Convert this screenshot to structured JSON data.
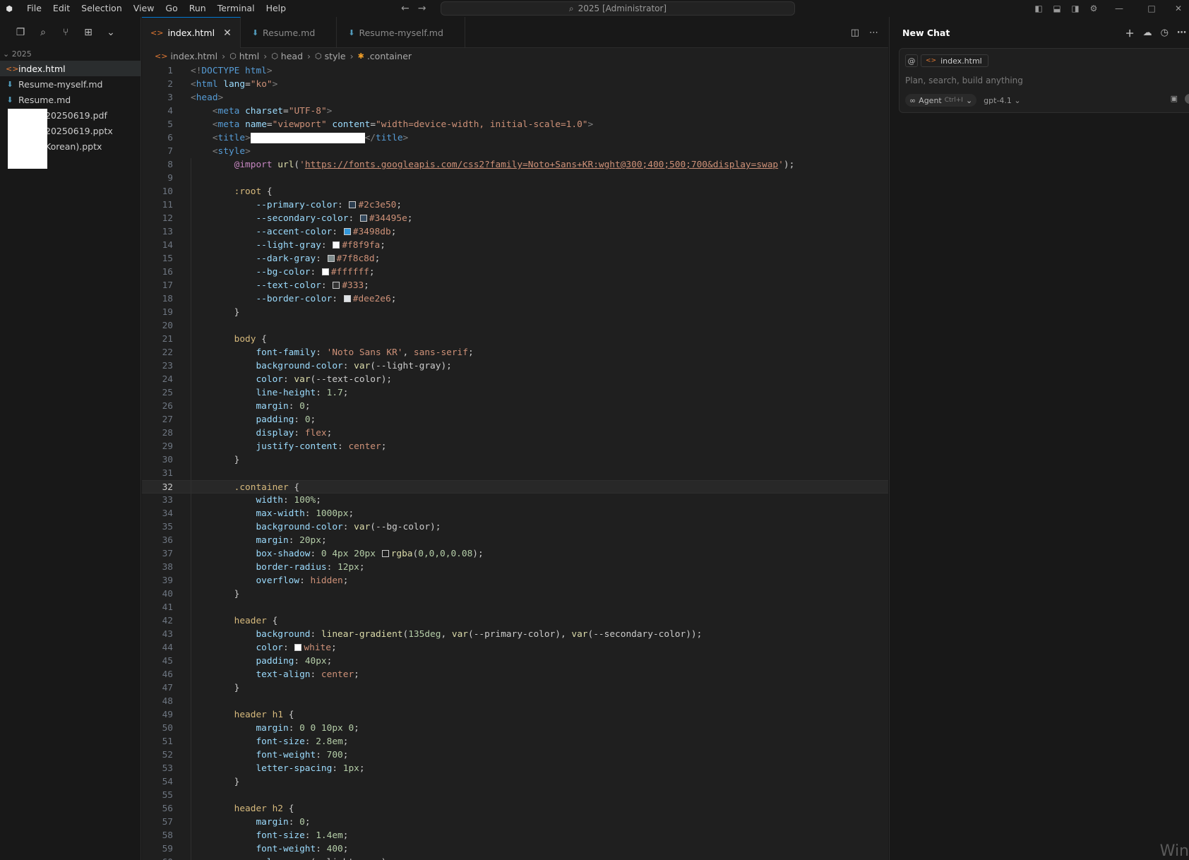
{
  "window": {
    "title": "2025 [Administrator]",
    "menu": [
      "File",
      "Edit",
      "Selection",
      "View",
      "Go",
      "Run",
      "Terminal",
      "Help"
    ]
  },
  "sidebar": {
    "folder": "2025",
    "files": [
      {
        "name": "index.html",
        "icon": "html-icon",
        "active": true
      },
      {
        "name": "Resume-myself.md",
        "icon": "markdown-icon",
        "active": false
      },
      {
        "name": "Resume.md",
        "icon": "markdown-icon",
        "active": false
      },
      {
        "name": "20250619.pdf",
        "icon": "pdf-icon",
        "active": false
      },
      {
        "name": "20250619.pptx",
        "icon": "pptx-icon",
        "active": false
      },
      {
        "name": "Korean).pptx",
        "icon": "pptx-icon",
        "active": false
      }
    ]
  },
  "tabs": [
    {
      "label": "index.html",
      "active": true
    },
    {
      "label": "Resume.md",
      "active": false
    },
    {
      "label": "Resume-myself.md",
      "active": false
    }
  ],
  "breadcrumb": [
    "index.html",
    "html",
    "head",
    "style",
    ".container"
  ],
  "editor": {
    "current_line": 32,
    "lines": [
      [
        [
          "t-punc",
          "<!"
        ],
        [
          "t-tag",
          "DOCTYPE html"
        ],
        [
          "t-punc",
          ">"
        ]
      ],
      [
        [
          "t-punc",
          "<"
        ],
        [
          "t-tag",
          "html"
        ],
        [
          "t-attr",
          " lang"
        ],
        [
          "t-wht",
          "="
        ],
        [
          "t-str",
          "\"ko\""
        ],
        [
          "t-punc",
          ">"
        ]
      ],
      [
        [
          "t-punc",
          "<"
        ],
        [
          "t-tag",
          "head"
        ],
        [
          "t-punc",
          ">"
        ]
      ],
      [
        [
          "t-wht",
          "    "
        ],
        [
          "t-punc",
          "<"
        ],
        [
          "t-tag",
          "meta"
        ],
        [
          "t-attr",
          " charset"
        ],
        [
          "t-wht",
          "="
        ],
        [
          "t-str",
          "\"UTF-8\""
        ],
        [
          "t-punc",
          ">"
        ]
      ],
      [
        [
          "t-wht",
          "    "
        ],
        [
          "t-punc",
          "<"
        ],
        [
          "t-tag",
          "meta"
        ],
        [
          "t-attr",
          " name"
        ],
        [
          "t-wht",
          "="
        ],
        [
          "t-str",
          "\"viewport\""
        ],
        [
          "t-attr",
          " content"
        ],
        [
          "t-wht",
          "="
        ],
        [
          "t-str",
          "\"width=device-width, initial-scale=1.0\""
        ],
        [
          "t-punc",
          ">"
        ]
      ],
      [
        [
          "t-wht",
          "    "
        ],
        [
          "t-punc",
          "<"
        ],
        [
          "t-tag",
          "title"
        ],
        [
          "t-punc",
          ">"
        ],
        [
          "redact",
          "                     "
        ],
        [
          "t-punc",
          "</"
        ],
        [
          "t-tag",
          "title"
        ],
        [
          "t-punc",
          ">"
        ]
      ],
      [
        [
          "t-wht",
          "    "
        ],
        [
          "t-punc",
          "<"
        ],
        [
          "t-tag",
          "style"
        ],
        [
          "t-punc",
          ">"
        ]
      ],
      [
        [
          "t-wht",
          "        "
        ],
        [
          "t-kw",
          "@import"
        ],
        [
          "t-wht",
          " "
        ],
        [
          "t-fn",
          "url"
        ],
        [
          "t-wht",
          "("
        ],
        [
          "t-str",
          "'"
        ],
        [
          "t-url",
          "https://fonts.googleapis.com/css2?family=Noto+Sans+KR:wght@300;400;500;700&display=swap"
        ],
        [
          "t-str",
          "'"
        ],
        [
          "t-wht",
          ");"
        ]
      ],
      [],
      [
        [
          "t-wht",
          "        "
        ],
        [
          "t-sel",
          ":root"
        ],
        [
          "t-wht",
          " {"
        ]
      ],
      [
        [
          "t-wht",
          "            "
        ],
        [
          "t-prop",
          "--primary-color"
        ],
        [
          "t-wht",
          ": "
        ],
        [
          "swatch",
          "#2c3e50"
        ],
        [
          "t-val",
          "#2c3e50"
        ],
        [
          "t-wht",
          ";"
        ]
      ],
      [
        [
          "t-wht",
          "            "
        ],
        [
          "t-prop",
          "--secondary-color"
        ],
        [
          "t-wht",
          ": "
        ],
        [
          "swatch",
          "#34495e"
        ],
        [
          "t-val",
          "#34495e"
        ],
        [
          "t-wht",
          ";"
        ]
      ],
      [
        [
          "t-wht",
          "            "
        ],
        [
          "t-prop",
          "--accent-color"
        ],
        [
          "t-wht",
          ": "
        ],
        [
          "swatch",
          "#3498db"
        ],
        [
          "t-val",
          "#3498db"
        ],
        [
          "t-wht",
          ";"
        ]
      ],
      [
        [
          "t-wht",
          "            "
        ],
        [
          "t-prop",
          "--light-gray"
        ],
        [
          "t-wht",
          ": "
        ],
        [
          "swatch",
          "#f8f9fa"
        ],
        [
          "t-val",
          "#f8f9fa"
        ],
        [
          "t-wht",
          ";"
        ]
      ],
      [
        [
          "t-wht",
          "            "
        ],
        [
          "t-prop",
          "--dark-gray"
        ],
        [
          "t-wht",
          ": "
        ],
        [
          "swatch",
          "#7f8c8d"
        ],
        [
          "t-val",
          "#7f8c8d"
        ],
        [
          "t-wht",
          ";"
        ]
      ],
      [
        [
          "t-wht",
          "            "
        ],
        [
          "t-prop",
          "--bg-color"
        ],
        [
          "t-wht",
          ": "
        ],
        [
          "swatch",
          "#ffffff"
        ],
        [
          "t-val",
          "#ffffff"
        ],
        [
          "t-wht",
          ";"
        ]
      ],
      [
        [
          "t-wht",
          "            "
        ],
        [
          "t-prop",
          "--text-color"
        ],
        [
          "t-wht",
          ": "
        ],
        [
          "swatch",
          "#333"
        ],
        [
          "t-val",
          "#333"
        ],
        [
          "t-wht",
          ";"
        ]
      ],
      [
        [
          "t-wht",
          "            "
        ],
        [
          "t-prop",
          "--border-color"
        ],
        [
          "t-wht",
          ": "
        ],
        [
          "swatch",
          "#dee2e6"
        ],
        [
          "t-val",
          "#dee2e6"
        ],
        [
          "t-wht",
          ";"
        ]
      ],
      [
        [
          "t-wht",
          "        }"
        ]
      ],
      [],
      [
        [
          "t-wht",
          "        "
        ],
        [
          "t-sel",
          "body"
        ],
        [
          "t-wht",
          " {"
        ]
      ],
      [
        [
          "t-wht",
          "            "
        ],
        [
          "t-prop",
          "font-family"
        ],
        [
          "t-wht",
          ": "
        ],
        [
          "t-val",
          "'Noto Sans KR'"
        ],
        [
          "t-wht",
          ", "
        ],
        [
          "t-val",
          "sans-serif"
        ],
        [
          "t-wht",
          ";"
        ]
      ],
      [
        [
          "t-wht",
          "            "
        ],
        [
          "t-prop",
          "background-color"
        ],
        [
          "t-wht",
          ": "
        ],
        [
          "t-fn",
          "var"
        ],
        [
          "t-wht",
          "(--light-gray);"
        ]
      ],
      [
        [
          "t-wht",
          "            "
        ],
        [
          "t-prop",
          "color"
        ],
        [
          "t-wht",
          ": "
        ],
        [
          "t-fn",
          "var"
        ],
        [
          "t-wht",
          "(--text-color);"
        ]
      ],
      [
        [
          "t-wht",
          "            "
        ],
        [
          "t-prop",
          "line-height"
        ],
        [
          "t-wht",
          ": "
        ],
        [
          "t-num",
          "1.7"
        ],
        [
          "t-wht",
          ";"
        ]
      ],
      [
        [
          "t-wht",
          "            "
        ],
        [
          "t-prop",
          "margin"
        ],
        [
          "t-wht",
          ": "
        ],
        [
          "t-num",
          "0"
        ],
        [
          "t-wht",
          ";"
        ]
      ],
      [
        [
          "t-wht",
          "            "
        ],
        [
          "t-prop",
          "padding"
        ],
        [
          "t-wht",
          ": "
        ],
        [
          "t-num",
          "0"
        ],
        [
          "t-wht",
          ";"
        ]
      ],
      [
        [
          "t-wht",
          "            "
        ],
        [
          "t-prop",
          "display"
        ],
        [
          "t-wht",
          ": "
        ],
        [
          "t-val",
          "flex"
        ],
        [
          "t-wht",
          ";"
        ]
      ],
      [
        [
          "t-wht",
          "            "
        ],
        [
          "t-prop",
          "justify-content"
        ],
        [
          "t-wht",
          ": "
        ],
        [
          "t-val",
          "center"
        ],
        [
          "t-wht",
          ";"
        ]
      ],
      [
        [
          "t-wht",
          "        }"
        ]
      ],
      [],
      [
        [
          "t-wht",
          "        "
        ],
        [
          "t-sel",
          ".container"
        ],
        [
          "t-wht",
          " {"
        ]
      ],
      [
        [
          "t-wht",
          "            "
        ],
        [
          "t-prop",
          "width"
        ],
        [
          "t-wht",
          ": "
        ],
        [
          "t-num",
          "100%"
        ],
        [
          "t-wht",
          ";"
        ]
      ],
      [
        [
          "t-wht",
          "            "
        ],
        [
          "t-prop",
          "max-width"
        ],
        [
          "t-wht",
          ": "
        ],
        [
          "t-num",
          "1000px"
        ],
        [
          "t-wht",
          ";"
        ]
      ],
      [
        [
          "t-wht",
          "            "
        ],
        [
          "t-prop",
          "background-color"
        ],
        [
          "t-wht",
          ": "
        ],
        [
          "t-fn",
          "var"
        ],
        [
          "t-wht",
          "(--bg-color);"
        ]
      ],
      [
        [
          "t-wht",
          "            "
        ],
        [
          "t-prop",
          "margin"
        ],
        [
          "t-wht",
          ": "
        ],
        [
          "t-num",
          "20px"
        ],
        [
          "t-wht",
          ";"
        ]
      ],
      [
        [
          "t-wht",
          "            "
        ],
        [
          "t-prop",
          "box-shadow"
        ],
        [
          "t-wht",
          ": "
        ],
        [
          "t-num",
          "0 4px 20px"
        ],
        [
          "t-wht",
          " "
        ],
        [
          "swatch",
          "transparent"
        ],
        [
          "t-fn",
          "rgba"
        ],
        [
          "t-wht",
          "("
        ],
        [
          "t-num",
          "0,0,0,0.08"
        ],
        [
          "t-wht",
          ");"
        ]
      ],
      [
        [
          "t-wht",
          "            "
        ],
        [
          "t-prop",
          "border-radius"
        ],
        [
          "t-wht",
          ": "
        ],
        [
          "t-num",
          "12px"
        ],
        [
          "t-wht",
          ";"
        ]
      ],
      [
        [
          "t-wht",
          "            "
        ],
        [
          "t-prop",
          "overflow"
        ],
        [
          "t-wht",
          ": "
        ],
        [
          "t-val",
          "hidden"
        ],
        [
          "t-wht",
          ";"
        ]
      ],
      [
        [
          "t-wht",
          "        }"
        ]
      ],
      [],
      [
        [
          "t-wht",
          "        "
        ],
        [
          "t-sel",
          "header"
        ],
        [
          "t-wht",
          " {"
        ]
      ],
      [
        [
          "t-wht",
          "            "
        ],
        [
          "t-prop",
          "background"
        ],
        [
          "t-wht",
          ": "
        ],
        [
          "t-fn",
          "linear-gradient"
        ],
        [
          "t-wht",
          "("
        ],
        [
          "t-num",
          "135deg"
        ],
        [
          "t-wht",
          ", "
        ],
        [
          "t-fn",
          "var"
        ],
        [
          "t-wht",
          "(--primary-color), "
        ],
        [
          "t-fn",
          "var"
        ],
        [
          "t-wht",
          "(--secondary-color));"
        ]
      ],
      [
        [
          "t-wht",
          "            "
        ],
        [
          "t-prop",
          "color"
        ],
        [
          "t-wht",
          ": "
        ],
        [
          "swatch",
          "#ffffff"
        ],
        [
          "t-val",
          "white"
        ],
        [
          "t-wht",
          ";"
        ]
      ],
      [
        [
          "t-wht",
          "            "
        ],
        [
          "t-prop",
          "padding"
        ],
        [
          "t-wht",
          ": "
        ],
        [
          "t-num",
          "40px"
        ],
        [
          "t-wht",
          ";"
        ]
      ],
      [
        [
          "t-wht",
          "            "
        ],
        [
          "t-prop",
          "text-align"
        ],
        [
          "t-wht",
          ": "
        ],
        [
          "t-val",
          "center"
        ],
        [
          "t-wht",
          ";"
        ]
      ],
      [
        [
          "t-wht",
          "        }"
        ]
      ],
      [],
      [
        [
          "t-wht",
          "        "
        ],
        [
          "t-sel",
          "header h1"
        ],
        [
          "t-wht",
          " {"
        ]
      ],
      [
        [
          "t-wht",
          "            "
        ],
        [
          "t-prop",
          "margin"
        ],
        [
          "t-wht",
          ": "
        ],
        [
          "t-num",
          "0 0 10px 0"
        ],
        [
          "t-wht",
          ";"
        ]
      ],
      [
        [
          "t-wht",
          "            "
        ],
        [
          "t-prop",
          "font-size"
        ],
        [
          "t-wht",
          ": "
        ],
        [
          "t-num",
          "2.8em"
        ],
        [
          "t-wht",
          ";"
        ]
      ],
      [
        [
          "t-wht",
          "            "
        ],
        [
          "t-prop",
          "font-weight"
        ],
        [
          "t-wht",
          ": "
        ],
        [
          "t-num",
          "700"
        ],
        [
          "t-wht",
          ";"
        ]
      ],
      [
        [
          "t-wht",
          "            "
        ],
        [
          "t-prop",
          "letter-spacing"
        ],
        [
          "t-wht",
          ": "
        ],
        [
          "t-num",
          "1px"
        ],
        [
          "t-wht",
          ";"
        ]
      ],
      [
        [
          "t-wht",
          "        }"
        ]
      ],
      [],
      [
        [
          "t-wht",
          "        "
        ],
        [
          "t-sel",
          "header h2"
        ],
        [
          "t-wht",
          " {"
        ]
      ],
      [
        [
          "t-wht",
          "            "
        ],
        [
          "t-prop",
          "margin"
        ],
        [
          "t-wht",
          ": "
        ],
        [
          "t-num",
          "0"
        ],
        [
          "t-wht",
          ";"
        ]
      ],
      [
        [
          "t-wht",
          "            "
        ],
        [
          "t-prop",
          "font-size"
        ],
        [
          "t-wht",
          ": "
        ],
        [
          "t-num",
          "1.4em"
        ],
        [
          "t-wht",
          ";"
        ]
      ],
      [
        [
          "t-wht",
          "            "
        ],
        [
          "t-prop",
          "font-weight"
        ],
        [
          "t-wht",
          ": "
        ],
        [
          "t-num",
          "400"
        ],
        [
          "t-wht",
          ";"
        ]
      ],
      [
        [
          "t-wht",
          "            "
        ],
        [
          "t-prop",
          "color"
        ],
        [
          "t-wht",
          ": "
        ],
        [
          "t-fn",
          "var"
        ],
        [
          "t-wht",
          "(--light-gray);"
        ]
      ]
    ]
  },
  "chat": {
    "title": "New Chat",
    "context_file": "index.html",
    "placeholder": "Plan, search, build anything",
    "mode": "Agent",
    "mode_shortcut": "Ctrl+I",
    "model": "gpt-4.1"
  },
  "watermark": "Win"
}
